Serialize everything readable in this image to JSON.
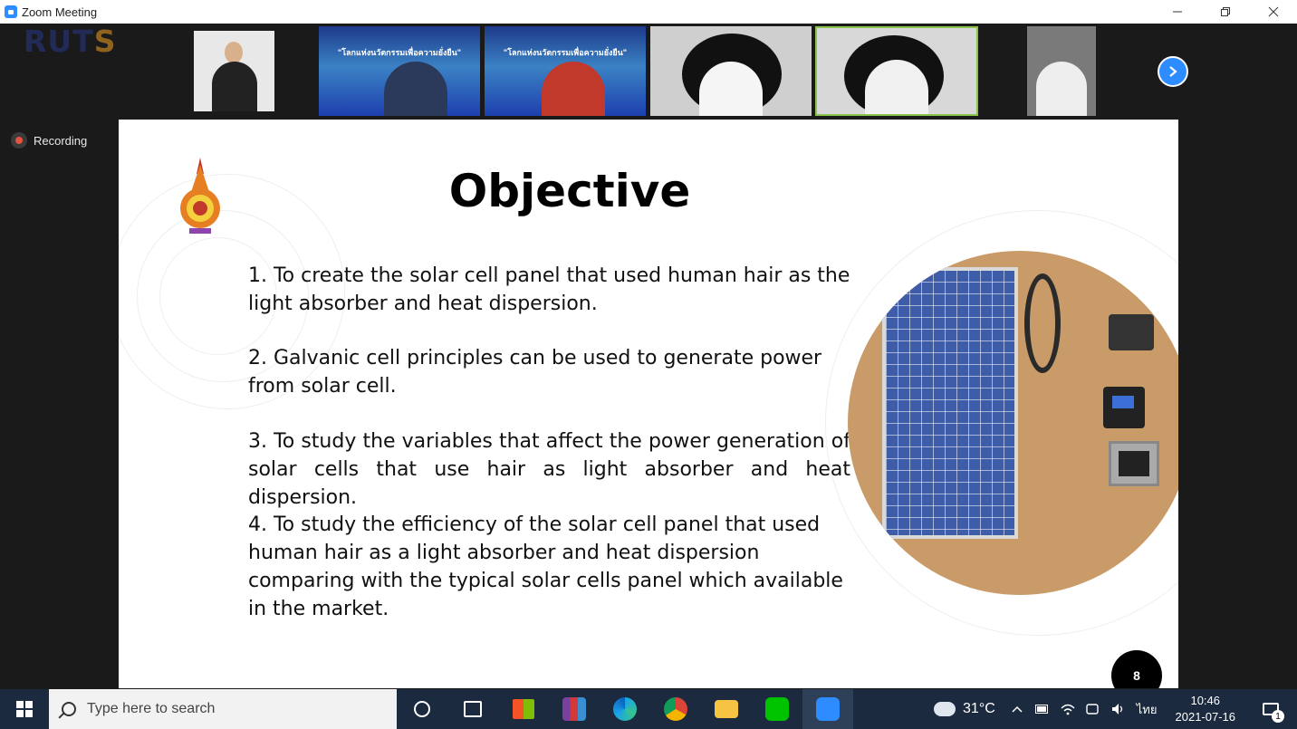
{
  "window": {
    "title": "Zoom Meeting",
    "minimize_icon": "minimize-icon",
    "maximize_icon": "restore-icon",
    "close_icon": "close-icon"
  },
  "watermark": {
    "brand_main": "RUT",
    "brand_accent": "S"
  },
  "gallery": {
    "thumbnail_banner_text": "\"โลกแห่งนวัตกรรมเพื่อความยั่งยืน\"",
    "next_page_icon": "chevron-right-icon"
  },
  "recording": {
    "label": "Recording"
  },
  "slide": {
    "title": "Objective",
    "objectives": [
      "1.  To create the solar cell panel that used human hair as the light absorber and heat dispersion.",
      "2. Galvanic cell principles can be used to generate power from solar cell.",
      "3. To study the variables that affect the power generation of solar cells that use hair as light absorber and heat dispersion.",
      "4. To study the efficiency of the solar cell panel that used human hair as a light absorber and heat dispersion comparing with the typical solar cells panel which available in the market."
    ],
    "page_number": "8"
  },
  "taskbar": {
    "search_placeholder": "Type here to search",
    "apps": [
      "cortana",
      "task-view",
      "microsoft-store",
      "winrar",
      "edge",
      "chrome",
      "file-explorer",
      "line",
      "zoom"
    ],
    "weather_temp": "31°C",
    "language": "ไทย",
    "time": "10:46",
    "date": "2021-07-16",
    "notification_count": "1"
  },
  "colors": {
    "zoom_blue": "#2d8cff",
    "recording_red": "#e5533d",
    "active_speaker_border": "#8bc34a",
    "taskbar_bg": "#1c2a3f"
  }
}
